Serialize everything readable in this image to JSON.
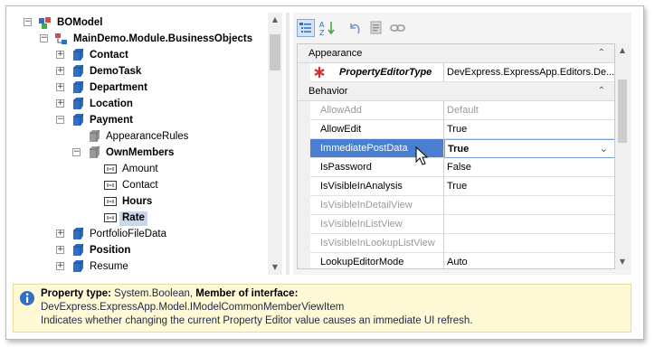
{
  "tree": {
    "items": [
      {
        "label": "BOModel",
        "bold": true,
        "level": 0,
        "expander": "−",
        "icon": "package-icon"
      },
      {
        "label": "MainDemo.Module.BusinessObjects",
        "bold": true,
        "level": 1,
        "expander": "−",
        "icon": "namespace-icon"
      },
      {
        "label": "Contact",
        "bold": true,
        "level": 2,
        "expander": "+",
        "icon": "class-icon"
      },
      {
        "label": "DemoTask",
        "bold": true,
        "level": 2,
        "expander": "+",
        "icon": "class-icon"
      },
      {
        "label": "Department",
        "bold": true,
        "level": 2,
        "expander": "+",
        "icon": "class-icon"
      },
      {
        "label": "Location",
        "bold": true,
        "level": 2,
        "expander": "+",
        "icon": "class-icon"
      },
      {
        "label": "Payment",
        "bold": true,
        "level": 2,
        "expander": "−",
        "icon": "class-icon"
      },
      {
        "label": "AppearanceRules",
        "bold": false,
        "level": 3,
        "expander": "",
        "icon": "grey-node-icon"
      },
      {
        "label": "OwnMembers",
        "bold": true,
        "level": 3,
        "expander": "−",
        "icon": "grey-node-icon"
      },
      {
        "label": "Amount",
        "bold": false,
        "level": 4,
        "expander": "",
        "icon": "member-icon"
      },
      {
        "label": "Contact",
        "bold": false,
        "level": 4,
        "expander": "",
        "icon": "member-icon"
      },
      {
        "label": "Hours",
        "bold": true,
        "level": 4,
        "expander": "",
        "icon": "member-icon"
      },
      {
        "label": "Rate",
        "bold": true,
        "level": 4,
        "expander": "",
        "icon": "member-icon",
        "selected": true
      },
      {
        "label": "PortfolioFileData",
        "bold": false,
        "level": 2,
        "expander": "+",
        "icon": "class-icon"
      },
      {
        "label": "Position",
        "bold": true,
        "level": 2,
        "expander": "+",
        "icon": "class-icon"
      },
      {
        "label": "Resume",
        "bold": false,
        "level": 2,
        "expander": "+",
        "icon": "class-icon"
      }
    ]
  },
  "toolbar": {
    "buttons": [
      {
        "icon": "categorized-icon",
        "pressed": true
      },
      {
        "icon": "sort-alphabetical-icon",
        "pressed": false
      },
      {
        "icon": "undo-icon",
        "pressed": false
      },
      {
        "icon": "navigate-icon",
        "pressed": false
      },
      {
        "icon": "link-icon",
        "pressed": false
      }
    ]
  },
  "grid": {
    "categories": [
      {
        "label": "Appearance",
        "collapse_glyph": "⌃"
      },
      {
        "label": "Behavior",
        "collapse_glyph": "⌃"
      }
    ],
    "appearance_rows": [
      {
        "name": "PropertyEditorType",
        "value": "DevExpress.ExpressApp.Editors.De..."
      }
    ],
    "behavior_rows": [
      {
        "name": "AllowAdd",
        "value": "Default",
        "dim": true
      },
      {
        "name": "AllowEdit",
        "value": "True",
        "dim": false
      },
      {
        "name": "ImmediatePostData",
        "value": "True",
        "dim": false,
        "selected": true,
        "dropdown": "⌄"
      },
      {
        "name": "IsPassword",
        "value": "False",
        "dim": false
      },
      {
        "name": "IsVisibleInAnalysis",
        "value": "True",
        "dim": false
      },
      {
        "name": "IsVisibleInDetailView",
        "value": "",
        "dim": true
      },
      {
        "name": "IsVisibleInListView",
        "value": "",
        "dim": true
      },
      {
        "name": "IsVisibleInLookupListView",
        "value": "",
        "dim": true
      },
      {
        "name": "LookupEditorMode",
        "value": "Auto",
        "dim": false
      }
    ]
  },
  "info": {
    "line1_prefix": "Property type:",
    "line1_type": " System.Boolean,",
    "line1_member_label": " Member of interface:",
    "line2": "DevExpress.ExpressApp.Model.IModelCommonMemberViewItem",
    "line3": "Indicates whether changing the current Property Editor value causes an immediate UI refresh."
  },
  "colors": {
    "selection": "#4a7fcf",
    "tree_selection": "#c9d7ea",
    "info_background": "#fff9d6",
    "class_icon": "#2f6fc4"
  }
}
